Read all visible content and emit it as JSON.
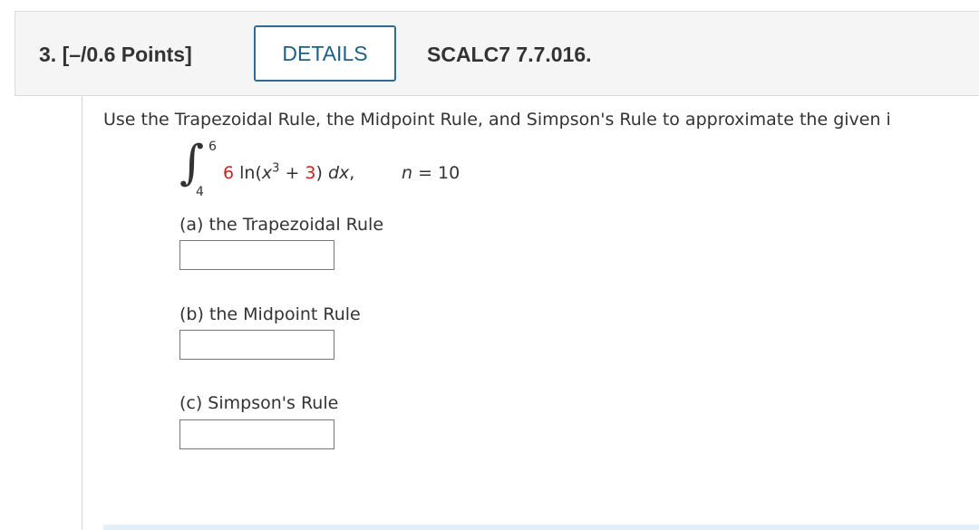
{
  "header": {
    "question_number": "3.",
    "points": "[–/0.6 Points]",
    "details_label": "DETAILS",
    "reference": "SCALC7 7.7.016."
  },
  "problem": {
    "instructions": "Use the Trapezoidal Rule, the Midpoint Rule, and Simpson's Rule to approximate the given i",
    "integral": {
      "upper_limit": "6",
      "lower_limit": "4",
      "coefficient": "6",
      "function_prefix": "ln(",
      "variable": "x",
      "exponent": "3",
      "plus": " + ",
      "constant": "3",
      "closing": ")",
      "differential": "dx",
      "comma": ",",
      "n_label": "n",
      "n_equals": " = 10"
    },
    "parts": [
      {
        "label": "(a) the Trapezoidal Rule",
        "value": ""
      },
      {
        "label": "(b) the Midpoint Rule",
        "value": ""
      },
      {
        "label": "(c) Simpson's Rule",
        "value": ""
      }
    ]
  },
  "colors": {
    "accent": "#1f5f84",
    "highlight": "#cc2222"
  }
}
